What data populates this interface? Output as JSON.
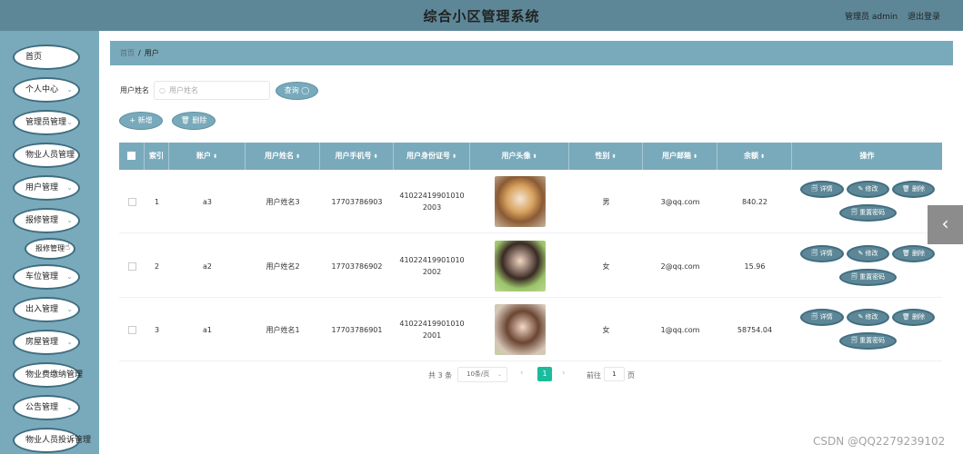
{
  "header": {
    "title": "综合小区管理系统",
    "user": "管理员 admin",
    "logout": "退出登录"
  },
  "sidebar": {
    "items": [
      {
        "label": "首页",
        "has_arrow": false
      },
      {
        "label": "个人中心",
        "has_arrow": true
      },
      {
        "label": "管理员管理",
        "has_arrow": true
      },
      {
        "label": "物业人员管理",
        "has_arrow": false
      },
      {
        "label": "用户管理",
        "has_arrow": true
      },
      {
        "label": "报修管理",
        "has_arrow": true
      },
      {
        "label": "车位管理",
        "has_arrow": true
      },
      {
        "label": "出入管理",
        "has_arrow": true
      },
      {
        "label": "房屋管理",
        "has_arrow": true
      },
      {
        "label": "物业费缴纳管理",
        "has_arrow": false
      },
      {
        "label": "公告管理",
        "has_arrow": true
      },
      {
        "label": "物业人员投诉管理",
        "has_arrow": false
      }
    ],
    "submenu": {
      "label": "报修管理",
      "icon": "cursor-hand-icon"
    },
    "chevron_glyph": "⌄"
  },
  "breadcrumb": {
    "home": "首页",
    "separator": "/",
    "current": "用户"
  },
  "search": {
    "label": "用户姓名",
    "placeholder": "用户姓名",
    "query_button": "查询 ",
    "search_icon": "search-icon"
  },
  "actions": {
    "add": "+ 新增",
    "delete": "🗑 删除"
  },
  "table": {
    "headers": [
      "索引",
      "账户",
      "用户姓名",
      "用户手机号",
      "用户身份证号",
      "用户头像",
      "性别",
      "用户邮箱",
      "余额",
      "操作"
    ],
    "sort_glyph": "⬍",
    "rows": [
      {
        "index": "1",
        "account": "a3",
        "name": "用户姓名3",
        "phone": "17703786903",
        "idcard": "410224199010102003",
        "avatar": "shiba-dog-photo",
        "gender": "男",
        "email": "3@qq.com",
        "balance": "840.22"
      },
      {
        "index": "2",
        "account": "a2",
        "name": "用户姓名2",
        "phone": "17703786902",
        "idcard": "410224199010102002",
        "avatar": "girl-portrait-photo",
        "gender": "女",
        "email": "2@qq.com",
        "balance": "15.96"
      },
      {
        "index": "3",
        "account": "a1",
        "name": "用户姓名1",
        "phone": "17703786901",
        "idcard": "410224199010102001",
        "avatar": "woman-portrait-photo",
        "gender": "女",
        "email": "1@qq.com",
        "balance": "58754.04"
      }
    ],
    "ops": {
      "detail": "🗐 详情",
      "edit": "✎ 修改",
      "delete": "🗑 删除",
      "reset": "🗐 重置密码"
    }
  },
  "pagination": {
    "total": "共 3 条",
    "page_size": "10条/页",
    "current_page": "1",
    "goto_label": "前往",
    "goto_value": "1",
    "page_suffix": "页"
  },
  "side_tab": {
    "glyph": "‹"
  },
  "watermark": "CSDN @QQ2279239102",
  "colors": {
    "header_bg": "#5d8797",
    "sidebar_bg": "#79aabb",
    "accent": "#79aabb",
    "page_active": "#1abc9c"
  }
}
